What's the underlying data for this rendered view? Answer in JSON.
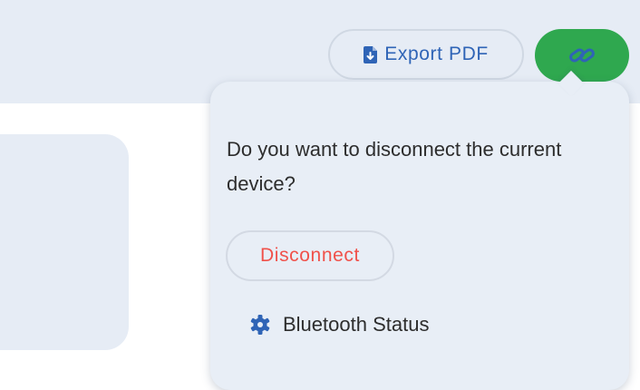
{
  "toolbar": {
    "export_label": "Export PDF",
    "export_icon": "file-pdf-icon",
    "link_icon": "link-icon",
    "link_button_color": "#2fa84f"
  },
  "popover": {
    "message": "Do you want to disconnect the current device?",
    "disconnect_label": "Disconnect",
    "disconnect_color": "#f0514a",
    "status_label": "Bluetooth Status",
    "status_icon": "gear-icon"
  },
  "colors": {
    "accent": "#2f64b6",
    "background": "#e6ecf5"
  }
}
